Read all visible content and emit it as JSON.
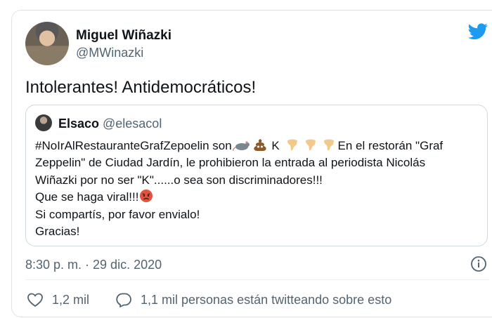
{
  "tweet": {
    "author_name": "Miguel Wiñazki",
    "author_handle": "@MWinazki",
    "text": "Intolerantes! Antidemocráticos!",
    "timestamp": "8:30 p. m. · 29 dic. 2020"
  },
  "quoted": {
    "author_name": "Elsaco",
    "author_handle": "@elesacol",
    "line1_a": "#NoIrAlRestauranteGrafZepoelin son",
    "line1_b": " K ",
    "line1_c": "En el restorán \"Graf",
    "line2": "Zeppelin\" de Ciudad Jardín,  le prohibieron la entrada al periodista  Nicolás",
    "line3": "Wiñazki por no ser \"K\"......o sea son discriminadores!!!",
    "line4": "Que se haga viral!!!",
    "line5": "Si compartís,  por favor envialo!",
    "line6": "Gracias!"
  },
  "actions": {
    "likes": "1,2 mil",
    "conversation": "1,1 mil personas están twitteando sobre esto"
  },
  "icons": [
    "twitter-bird-icon",
    "rat-emoji",
    "poop-emoji",
    "pointing-down-emoji",
    "angry-face-emoji",
    "info-icon",
    "heart-icon",
    "speech-bubble-icon"
  ],
  "colors": {
    "twitter_blue": "#1d9bf0",
    "secondary_text": "#536471",
    "border": "#cfd9de"
  }
}
